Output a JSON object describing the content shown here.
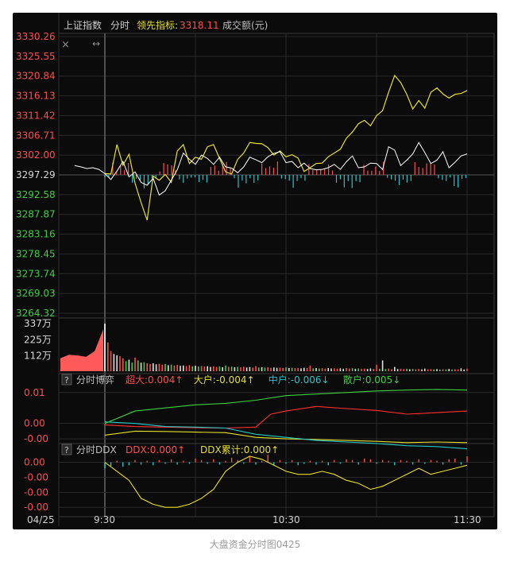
{
  "caption": "大盘资金分时图0425",
  "header": {
    "index_name": "上证指数",
    "mode": "分时",
    "leading_label": "领先指标:",
    "leading_value": "3318.11",
    "volume_label": "成交额(元)",
    "close_icon": "close-icon",
    "drag_icon": "resize-arrows-icon"
  },
  "colors": {
    "price_line": "#ffffff",
    "leading_line": "#e5df2a",
    "up": "#ff4c4c",
    "down": "#26c6c6",
    "green_label": "#3fcf3f",
    "grid": "#2a2a2a",
    "border": "#3a3a3a",
    "text_dim": "#bdbdbd"
  },
  "price_axis": {
    "up_labels": [
      "3330.26",
      "3325.55",
      "3320.84",
      "3316.13",
      "3311.42",
      "3306.71",
      "3302.00"
    ],
    "mid_label": "3297.29",
    "down_labels": [
      "3292.58",
      "3287.87",
      "3283.16",
      "3278.45",
      "3273.74",
      "3269.03",
      "3264.32"
    ]
  },
  "volume_axis": {
    "labels": [
      "337万",
      "225万",
      "112万"
    ]
  },
  "time_axis": {
    "labels": [
      "04/25",
      "9:30",
      "10:30",
      "11:30"
    ]
  },
  "boyi_panel": {
    "help_icon": "?",
    "title": "分时博弈",
    "items": [
      {
        "label": "超大:",
        "value": "0.004",
        "arrow": "↑",
        "color": "#ff4c4c"
      },
      {
        "label": "大户:",
        "value": "-0.004",
        "arrow": "↑",
        "color": "#e5df2a"
      },
      {
        "label": "中户:",
        "value": "-0.006",
        "arrow": "↓",
        "color": "#26c6c6"
      },
      {
        "label": "散户:",
        "value": "0.005",
        "arrow": "↓",
        "color": "#3fcf3f"
      }
    ],
    "y_labels": [
      "0.01",
      "0.00",
      "-0.00"
    ]
  },
  "ddx_panel": {
    "help_icon": "?",
    "title": "分时DDX",
    "items": [
      {
        "label": "DDX:",
        "value": "0.000",
        "arrow": "↑",
        "color": "#ff4c4c"
      },
      {
        "label": "DDX累计:",
        "value": "0.000",
        "arrow": "↑",
        "color": "#e5df2a"
      }
    ],
    "y_labels": [
      "0.00",
      "-0.00",
      "-0.00",
      "-0.00"
    ]
  },
  "chart_data": {
    "type": "line",
    "title": "上证指数 分时",
    "ylim": [
      3264.32,
      3330.26
    ],
    "prev_close": 3297.29,
    "x_minutes_range": [
      0,
      120
    ],
    "price_series": {
      "x": [
        -10,
        -8,
        -6,
        -4,
        -2,
        0,
        2,
        4,
        6,
        8,
        10,
        12,
        14,
        16,
        18,
        20,
        22,
        24,
        26,
        28,
        30,
        32,
        34,
        36,
        38,
        40,
        42,
        44,
        46,
        48,
        50,
        52,
        54,
        56,
        58,
        60,
        62,
        64,
        66,
        68,
        70,
        72,
        74,
        76,
        78,
        80,
        82,
        84,
        86,
        88,
        90,
        92,
        94,
        96,
        98,
        100,
        102,
        104,
        106,
        108,
        110,
        112,
        114,
        116,
        118,
        120
      ],
      "y": [
        3299.5,
        3299.2,
        3298.8,
        3299.0,
        3298.6,
        3297.6,
        3296.2,
        3298.2,
        3300.5,
        3296.8,
        3298.0,
        3295.5,
        3294.8,
        3296.5,
        3292.5,
        3293.5,
        3296.0,
        3298.5,
        3302.5,
        3301.0,
        3299.8,
        3302.0,
        3301.2,
        3299.8,
        3301.5,
        3299.2,
        3298.9,
        3297.8,
        3299.2,
        3301.5,
        3300.9,
        3300.2,
        3301.6,
        3302.4,
        3302.8,
        3300.2,
        3300.5,
        3299.0,
        3300.1,
        3298.8,
        3298.5,
        3298.6,
        3299.0,
        3299.8,
        3298.6,
        3300.4,
        3301.8,
        3299.0,
        3299.2,
        3300.1,
        3300.0,
        3298.6,
        3304.0,
        3303.2,
        3299.5,
        3300.8,
        3302.3,
        3305.0,
        3302.6,
        3300.0,
        3300.8,
        3302.8,
        3299.0,
        3300.3,
        3301.8,
        3302.3
      ]
    },
    "leading_series": {
      "x": [
        0,
        2,
        4,
        6,
        8,
        10,
        12,
        14,
        16,
        18,
        20,
        22,
        24,
        26,
        28,
        30,
        32,
        34,
        36,
        38,
        40,
        42,
        44,
        46,
        48,
        50,
        52,
        54,
        56,
        58,
        60,
        62,
        64,
        66,
        68,
        70,
        72,
        74,
        76,
        78,
        80,
        82,
        84,
        86,
        88,
        90,
        92,
        94,
        96,
        98,
        100,
        102,
        104,
        106,
        108,
        110,
        112,
        114,
        116,
        118,
        120
      ],
      "y": [
        3297.6,
        3297.5,
        3304.5,
        3299.6,
        3302.2,
        3295.3,
        3290.7,
        3286.5,
        3297.0,
        3296.0,
        3297.4,
        3295.5,
        3303.0,
        3304.5,
        3300.0,
        3301.5,
        3301.0,
        3304.0,
        3304.5,
        3301.2,
        3298.0,
        3297.5,
        3301.0,
        3302.5,
        3305.0,
        3304.8,
        3304.7,
        3303.8,
        3302.0,
        3303.0,
        3301.6,
        3302.1,
        3301.3,
        3298.1,
        3299.0,
        3300.0,
        3300.1,
        3301.6,
        3302.5,
        3303.4,
        3306.0,
        3307.5,
        3309.5,
        3310.3,
        3309.0,
        3311.4,
        3312.6,
        3317.0,
        3321.0,
        3319.3,
        3316.5,
        3313.0,
        3315.0,
        3313.2,
        3317.0,
        3318.0,
        3316.6,
        3315.6,
        3316.5,
        3316.7,
        3317.4
      ]
    },
    "volume_series": {
      "unit": "万",
      "ylim": [
        0,
        337
      ],
      "x": [
        0,
        1,
        2,
        3,
        4,
        5,
        6,
        7,
        8,
        9,
        10,
        11,
        12,
        13,
        14,
        15,
        16,
        17,
        18,
        19,
        20,
        21,
        22,
        23,
        24,
        25,
        26,
        27,
        28,
        29,
        30,
        31,
        32,
        33,
        34,
        35,
        36,
        37,
        38,
        39,
        40,
        41,
        42,
        43,
        44,
        45,
        46,
        47,
        48,
        49,
        50,
        51,
        52,
        53,
        54,
        55,
        56,
        57,
        58,
        59,
        60,
        61,
        62,
        63,
        64,
        65,
        66,
        67,
        68,
        69,
        70,
        71,
        72,
        73,
        74,
        75,
        76,
        77,
        78,
        79,
        80,
        81,
        82,
        83,
        84,
        85,
        86,
        87,
        88,
        89,
        90,
        91,
        92,
        93,
        94,
        95,
        96,
        97,
        98,
        99,
        100,
        101,
        102,
        103,
        104,
        105,
        106,
        107,
        108,
        109,
        110,
        111,
        112,
        113,
        114,
        115,
        116,
        117,
        118,
        119,
        120
      ],
      "values": [
        330,
        200,
        140,
        120,
        110,
        105,
        90,
        70,
        80,
        60,
        95,
        75,
        60,
        62,
        55,
        50,
        55,
        48,
        52,
        45,
        50,
        42,
        46,
        40,
        44,
        38,
        40,
        36,
        42,
        35,
        38,
        34,
        36,
        33,
        35,
        30,
        34,
        30,
        33,
        28,
        40,
        30,
        32,
        28,
        30,
        27,
        31,
        26,
        29,
        25,
        35,
        26,
        28,
        25,
        27,
        24,
        26,
        24,
        25,
        23,
        26,
        22,
        24,
        21,
        23,
        20,
        24,
        22,
        40,
        20,
        22,
        19,
        21,
        18,
        22,
        19,
        20,
        18,
        20,
        17,
        22,
        18,
        20,
        17,
        19,
        17,
        18,
        16,
        19,
        16,
        45,
        17,
        75,
        16,
        18,
        15,
        30,
        16,
        17,
        15,
        17,
        14,
        16,
        14,
        16,
        13,
        18,
        14,
        15,
        13,
        15,
        12,
        14,
        13,
        16,
        12,
        14,
        13,
        20,
        12,
        18
      ]
    },
    "auction_volume": {
      "x": [
        -10,
        -8,
        -6,
        -4,
        -2,
        0
      ],
      "values": [
        90,
        115,
        110,
        100,
        140,
        290
      ]
    },
    "boyi_series": {
      "ylim": [
        -0.006,
        0.012
      ],
      "series": [
        {
          "name": "超大",
          "x": [
            0,
            10,
            20,
            30,
            40,
            50,
            55,
            60,
            70,
            80,
            90,
            100,
            110,
            120
          ],
          "values": [
            -0.0005,
            -0.001,
            -0.0012,
            -0.0014,
            -0.0015,
            -0.0012,
            0.003,
            0.004,
            0.0055,
            0.0048,
            0.0042,
            0.003,
            0.0035,
            0.004
          ]
        },
        {
          "name": "大户",
          "x": [
            0,
            10,
            20,
            30,
            40,
            50,
            60,
            70,
            80,
            90,
            100,
            110,
            120
          ],
          "values": [
            -0.0038,
            -0.0025,
            -0.0026,
            -0.0028,
            -0.003,
            -0.0045,
            -0.005,
            -0.0052,
            -0.0055,
            -0.0058,
            -0.0062,
            -0.006,
            -0.0062
          ]
        },
        {
          "name": "中户",
          "x": [
            0,
            10,
            20,
            30,
            40,
            50,
            60,
            70,
            80,
            90,
            100,
            110,
            120
          ],
          "values": [
            0.0005,
            0.0,
            -0.001,
            -0.0012,
            -0.0015,
            -0.0035,
            -0.0045,
            -0.0055,
            -0.006,
            -0.0065,
            -0.0072,
            -0.0075,
            -0.0082
          ]
        },
        {
          "name": "散户",
          "x": [
            0,
            10,
            20,
            30,
            40,
            50,
            60,
            70,
            80,
            90,
            100,
            110,
            120
          ],
          "values": [
            0.0,
            0.004,
            0.005,
            0.006,
            0.0065,
            0.0075,
            0.009,
            0.0095,
            0.01,
            0.0105,
            0.0108,
            0.011,
            0.0108
          ]
        }
      ]
    },
    "ddx_series": {
      "ylim": [
        -0.0016,
        0.0002
      ],
      "cumulative": {
        "name": "DDX累计",
        "x": [
          0,
          4,
          8,
          12,
          16,
          20,
          24,
          28,
          32,
          36,
          40,
          44,
          48,
          52,
          56,
          60,
          64,
          68,
          72,
          76,
          80,
          84,
          88,
          92,
          96,
          100,
          104,
          108,
          112,
          116,
          120
        ],
        "values": [
          0.0,
          -0.0003,
          -0.0006,
          -0.0012,
          -0.0014,
          -0.0015,
          -0.0015,
          -0.0014,
          -0.0012,
          -0.0009,
          -0.0003,
          0.0,
          0.0002,
          0.0001,
          -0.0001,
          -0.0003,
          -0.0004,
          -0.0004,
          -0.0003,
          -0.0004,
          -0.0006,
          -0.0007,
          -0.0009,
          -0.0008,
          -0.0006,
          -0.0004,
          -0.0002,
          -0.0004,
          -0.0003,
          -0.0002,
          -0.0001
        ]
      },
      "bars": {
        "name": "DDX",
        "x": [
          0,
          2,
          4,
          6,
          8,
          10,
          12,
          14,
          16,
          18,
          20,
          22,
          24,
          26,
          28,
          30,
          32,
          34,
          36,
          38,
          40,
          42,
          44,
          46,
          48,
          50,
          52,
          54,
          56,
          58,
          60,
          62,
          64,
          66,
          68,
          70,
          72,
          74,
          76,
          78,
          80,
          82,
          84,
          86,
          88,
          90,
          92,
          94,
          96,
          98,
          100,
          102,
          104,
          106,
          108,
          110,
          112,
          114,
          116,
          118,
          120
        ],
        "values": [
          -8e-05,
          -5e-05,
          2e-05,
          -6e-05,
          -4e-05,
          3e-05,
          -3e-05,
          2e-05,
          -4e-05,
          3e-05,
          -2e-05,
          4e-05,
          -3e-05,
          2e-05,
          -2e-05,
          5e-05,
          3e-05,
          -2e-05,
          4e-05,
          -3e-05,
          2e-05,
          6e-05,
          3e-05,
          -2e-05,
          8e-05,
          -3e-05,
          2e-05,
          0.0001,
          -4e-05,
          3e-05,
          -2e-05,
          3e-05,
          -4e-05,
          -2e-05,
          2e-05,
          -3e-05,
          2e-05,
          -4e-05,
          3e-05,
          -2e-05,
          4e-05,
          3e-05,
          -3e-05,
          5e-05,
          4e-05,
          -2e-05,
          3e-05,
          2e-05,
          -4e-05,
          3e-05,
          2e-05,
          -3e-05,
          4e-05,
          -2e-05,
          3e-05,
          2e-05,
          -3e-05,
          4e-05,
          5e-05,
          -3e-05,
          8e-05
        ]
      }
    }
  }
}
